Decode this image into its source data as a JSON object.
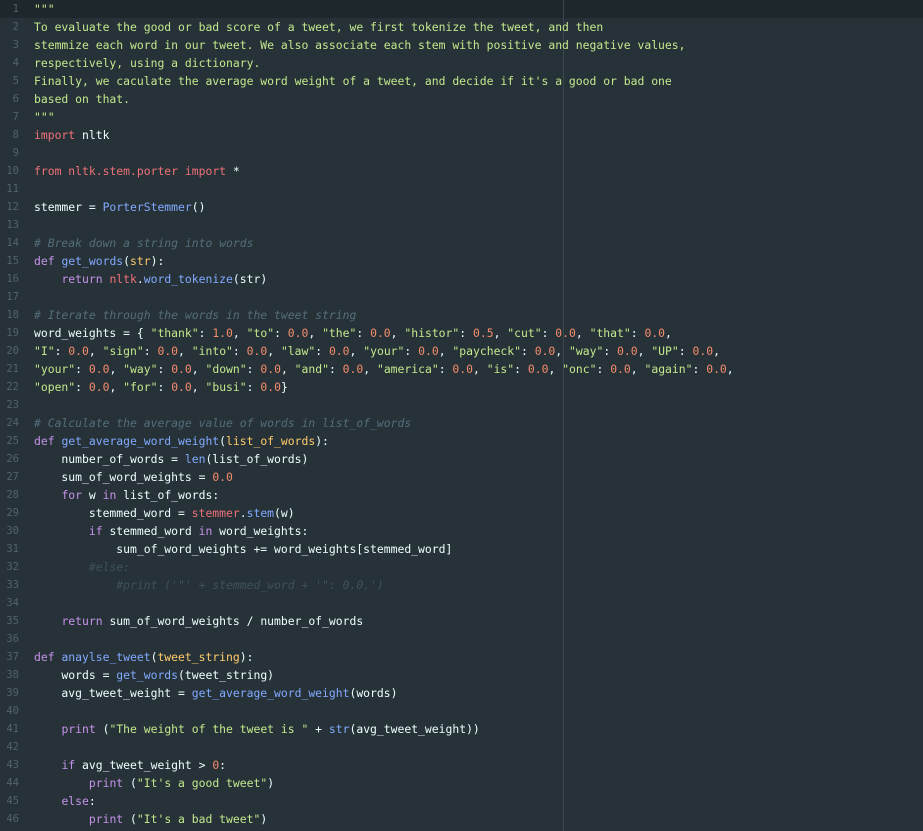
{
  "editor": {
    "lines": [
      {
        "n": "1",
        "t": [
          [
            "doc",
            "\"\"\""
          ]
        ]
      },
      {
        "n": "2",
        "t": [
          [
            "doc",
            "To evaluate the good or bad score of a tweet, we first tokenize the tweet, and then"
          ]
        ]
      },
      {
        "n": "3",
        "t": [
          [
            "doc",
            "stemmize each word in our tweet. We also associate each stem with positive and negative values,"
          ]
        ]
      },
      {
        "n": "4",
        "t": [
          [
            "doc",
            "respectively, using a dictionary."
          ]
        ]
      },
      {
        "n": "5",
        "t": [
          [
            "doc",
            "Finally, we caculate the average word weight of a tweet, and decide if it's a good or bad one"
          ]
        ]
      },
      {
        "n": "6",
        "t": [
          [
            "doc",
            "based on that."
          ]
        ]
      },
      {
        "n": "7",
        "t": [
          [
            "doc",
            "\"\"\""
          ]
        ]
      },
      {
        "n": "8",
        "t": [
          [
            "kwc",
            "import"
          ],
          [
            "id",
            " nltk"
          ]
        ]
      },
      {
        "n": "9",
        "t": []
      },
      {
        "n": "10",
        "t": [
          [
            "kwc",
            "from"
          ],
          [
            "id",
            " "
          ],
          [
            "red",
            "nltk.stem.porter"
          ],
          [
            "id",
            " "
          ],
          [
            "kwc",
            "import"
          ],
          [
            "id",
            " *"
          ]
        ]
      },
      {
        "n": "11",
        "t": []
      },
      {
        "n": "12",
        "t": [
          [
            "id",
            "stemmer = "
          ],
          [
            "fn",
            "PorterStemmer"
          ],
          [
            "id",
            "()"
          ]
        ]
      },
      {
        "n": "13",
        "t": []
      },
      {
        "n": "14",
        "t": [
          [
            "cm",
            "# Break down a string into words"
          ]
        ]
      },
      {
        "n": "15",
        "t": [
          [
            "kw",
            "def"
          ],
          [
            "id",
            " "
          ],
          [
            "fn",
            "get_words"
          ],
          [
            "id",
            "("
          ],
          [
            "mod",
            "str"
          ],
          [
            "id",
            "):"
          ]
        ]
      },
      {
        "n": "16",
        "t": [
          [
            "id",
            "    "
          ],
          [
            "kw",
            "return"
          ],
          [
            "id",
            " "
          ],
          [
            "red",
            "nltk"
          ],
          [
            "id",
            "."
          ],
          [
            "fn",
            "word_tokenize"
          ],
          [
            "id",
            "(str)"
          ]
        ]
      },
      {
        "n": "17",
        "t": []
      },
      {
        "n": "18",
        "t": [
          [
            "cm",
            "# Iterate through the words in the tweet string"
          ]
        ]
      },
      {
        "n": "19",
        "t": [
          [
            "id",
            "word_weights = { "
          ],
          [
            "str",
            "\"thank\""
          ],
          [
            "id",
            ": "
          ],
          [
            "num",
            "1.0"
          ],
          [
            "id",
            ", "
          ],
          [
            "str",
            "\"to\""
          ],
          [
            "id",
            ": "
          ],
          [
            "num",
            "0.0"
          ],
          [
            "id",
            ", "
          ],
          [
            "str",
            "\"the\""
          ],
          [
            "id",
            ": "
          ],
          [
            "num",
            "0.0"
          ],
          [
            "id",
            ", "
          ],
          [
            "str",
            "\"histor\""
          ],
          [
            "id",
            ": "
          ],
          [
            "num",
            "0.5"
          ],
          [
            "id",
            ", "
          ],
          [
            "str",
            "\"cut\""
          ],
          [
            "id",
            ": "
          ],
          [
            "num",
            "0.0"
          ],
          [
            "id",
            ", "
          ],
          [
            "str",
            "\"that\""
          ],
          [
            "id",
            ": "
          ],
          [
            "num",
            "0.0"
          ],
          [
            "id",
            ","
          ]
        ]
      },
      {
        "n": "20",
        "t": [
          [
            "str",
            "\"I\""
          ],
          [
            "id",
            ": "
          ],
          [
            "num",
            "0.0"
          ],
          [
            "id",
            ", "
          ],
          [
            "str",
            "\"sign\""
          ],
          [
            "id",
            ": "
          ],
          [
            "num",
            "0.0"
          ],
          [
            "id",
            ", "
          ],
          [
            "str",
            "\"into\""
          ],
          [
            "id",
            ": "
          ],
          [
            "num",
            "0.0"
          ],
          [
            "id",
            ", "
          ],
          [
            "str",
            "\"law\""
          ],
          [
            "id",
            ": "
          ],
          [
            "num",
            "0.0"
          ],
          [
            "id",
            ", "
          ],
          [
            "str",
            "\"your\""
          ],
          [
            "id",
            ": "
          ],
          [
            "num",
            "0.0"
          ],
          [
            "id",
            ", "
          ],
          [
            "str",
            "\"paycheck\""
          ],
          [
            "id",
            ": "
          ],
          [
            "num",
            "0.0"
          ],
          [
            "id",
            ", "
          ],
          [
            "str",
            "\"way\""
          ],
          [
            "id",
            ": "
          ],
          [
            "num",
            "0.0"
          ],
          [
            "id",
            ", "
          ],
          [
            "str",
            "\"UP\""
          ],
          [
            "id",
            ": "
          ],
          [
            "num",
            "0.0"
          ],
          [
            "id",
            ","
          ]
        ]
      },
      {
        "n": "21",
        "t": [
          [
            "str",
            "\"your\""
          ],
          [
            "id",
            ": "
          ],
          [
            "num",
            "0.0"
          ],
          [
            "id",
            ", "
          ],
          [
            "str",
            "\"way\""
          ],
          [
            "id",
            ": "
          ],
          [
            "num",
            "0.0"
          ],
          [
            "id",
            ", "
          ],
          [
            "str",
            "\"down\""
          ],
          [
            "id",
            ": "
          ],
          [
            "num",
            "0.0"
          ],
          [
            "id",
            ", "
          ],
          [
            "str",
            "\"and\""
          ],
          [
            "id",
            ": "
          ],
          [
            "num",
            "0.0"
          ],
          [
            "id",
            ", "
          ],
          [
            "str",
            "\"america\""
          ],
          [
            "id",
            ": "
          ],
          [
            "num",
            "0.0"
          ],
          [
            "id",
            ", "
          ],
          [
            "str",
            "\"is\""
          ],
          [
            "id",
            ": "
          ],
          [
            "num",
            "0.0"
          ],
          [
            "id",
            ", "
          ],
          [
            "str",
            "\"onc\""
          ],
          [
            "id",
            ": "
          ],
          [
            "num",
            "0.0"
          ],
          [
            "id",
            ", "
          ],
          [
            "str",
            "\"again\""
          ],
          [
            "id",
            ": "
          ],
          [
            "num",
            "0.0"
          ],
          [
            "id",
            ","
          ]
        ]
      },
      {
        "n": "22",
        "t": [
          [
            "str",
            "\"open\""
          ],
          [
            "id",
            ": "
          ],
          [
            "num",
            "0.0"
          ],
          [
            "id",
            ", "
          ],
          [
            "str",
            "\"for\""
          ],
          [
            "id",
            ": "
          ],
          [
            "num",
            "0.0"
          ],
          [
            "id",
            ", "
          ],
          [
            "str",
            "\"busi\""
          ],
          [
            "id",
            ": "
          ],
          [
            "num",
            "0.0"
          ],
          [
            "id",
            "}"
          ]
        ]
      },
      {
        "n": "23",
        "t": []
      },
      {
        "n": "24",
        "t": [
          [
            "cm",
            "# Calculate the average value of words in list_of_words"
          ]
        ]
      },
      {
        "n": "25",
        "t": [
          [
            "kw",
            "def"
          ],
          [
            "id",
            " "
          ],
          [
            "fn",
            "get_average_word_weight"
          ],
          [
            "id",
            "("
          ],
          [
            "mod",
            "list_of_words"
          ],
          [
            "id",
            "):"
          ]
        ]
      },
      {
        "n": "26",
        "t": [
          [
            "id",
            "    number_of_words = "
          ],
          [
            "fn",
            "len"
          ],
          [
            "id",
            "(list_of_words)"
          ]
        ]
      },
      {
        "n": "27",
        "t": [
          [
            "id",
            "    sum_of_word_weights = "
          ],
          [
            "num",
            "0.0"
          ]
        ]
      },
      {
        "n": "28",
        "t": [
          [
            "id",
            "    "
          ],
          [
            "kw",
            "for"
          ],
          [
            "id",
            " w "
          ],
          [
            "kw",
            "in"
          ],
          [
            "id",
            " list_of_words:"
          ]
        ]
      },
      {
        "n": "29",
        "t": [
          [
            "id",
            "        stemmed_word = "
          ],
          [
            "red",
            "stemmer"
          ],
          [
            "id",
            "."
          ],
          [
            "fn",
            "stem"
          ],
          [
            "id",
            "(w)"
          ]
        ]
      },
      {
        "n": "30",
        "t": [
          [
            "id",
            "        "
          ],
          [
            "kw",
            "if"
          ],
          [
            "id",
            " stemmed_word "
          ],
          [
            "kw",
            "in"
          ],
          [
            "id",
            " word_weights:"
          ]
        ]
      },
      {
        "n": "31",
        "t": [
          [
            "id",
            "            sum_of_word_weights += word_weights[stemmed_word]"
          ]
        ]
      },
      {
        "n": "32",
        "t": [
          [
            "id",
            "        "
          ],
          [
            "cmd",
            "#else:"
          ]
        ]
      },
      {
        "n": "33",
        "t": [
          [
            "id",
            "            "
          ],
          [
            "cmd",
            "#print ('\"' + stemmed_word + '\": 0.0,')"
          ]
        ]
      },
      {
        "n": "34",
        "t": []
      },
      {
        "n": "35",
        "t": [
          [
            "id",
            "    "
          ],
          [
            "kw",
            "return"
          ],
          [
            "id",
            " sum_of_word_weights / number_of_words"
          ]
        ]
      },
      {
        "n": "36",
        "t": []
      },
      {
        "n": "37",
        "t": [
          [
            "kw",
            "def"
          ],
          [
            "id",
            " "
          ],
          [
            "fn",
            "anaylse_tweet"
          ],
          [
            "id",
            "("
          ],
          [
            "mod",
            "tweet_string"
          ],
          [
            "id",
            "):"
          ]
        ]
      },
      {
        "n": "38",
        "t": [
          [
            "id",
            "    words = "
          ],
          [
            "fn",
            "get_words"
          ],
          [
            "id",
            "(tweet_string)"
          ]
        ]
      },
      {
        "n": "39",
        "t": [
          [
            "id",
            "    avg_tweet_weight = "
          ],
          [
            "fn",
            "get_average_word_weight"
          ],
          [
            "id",
            "(words)"
          ]
        ]
      },
      {
        "n": "40",
        "t": []
      },
      {
        "n": "41",
        "t": [
          [
            "id",
            "    "
          ],
          [
            "kw",
            "print"
          ],
          [
            "id",
            " ("
          ],
          [
            "str",
            "\"The weight of the tweet is \""
          ],
          [
            "id",
            " + "
          ],
          [
            "fn",
            "str"
          ],
          [
            "id",
            "(avg_tweet_weight))"
          ]
        ]
      },
      {
        "n": "42",
        "t": []
      },
      {
        "n": "43",
        "t": [
          [
            "id",
            "    "
          ],
          [
            "kw",
            "if"
          ],
          [
            "id",
            " avg_tweet_weight > "
          ],
          [
            "num",
            "0"
          ],
          [
            "id",
            ":"
          ]
        ]
      },
      {
        "n": "44",
        "t": [
          [
            "id",
            "        "
          ],
          [
            "kw",
            "print"
          ],
          [
            "id",
            " ("
          ],
          [
            "str",
            "\"It's a good tweet\""
          ],
          [
            "id",
            ")"
          ]
        ]
      },
      {
        "n": "45",
        "t": [
          [
            "id",
            "    "
          ],
          [
            "kw",
            "else"
          ],
          [
            "id",
            ":"
          ]
        ]
      },
      {
        "n": "46",
        "t": [
          [
            "id",
            "        "
          ],
          [
            "kw",
            "print"
          ],
          [
            "id",
            " ("
          ],
          [
            "str",
            "\"It's a bad tweet\""
          ],
          [
            "id",
            ")"
          ]
        ]
      }
    ]
  },
  "colors": {
    "background": "#263238",
    "keyword": "#c792ea",
    "function": "#82aaff",
    "string": "#c3e88d",
    "number": "#f78c6c",
    "comment": "#546e7a"
  }
}
